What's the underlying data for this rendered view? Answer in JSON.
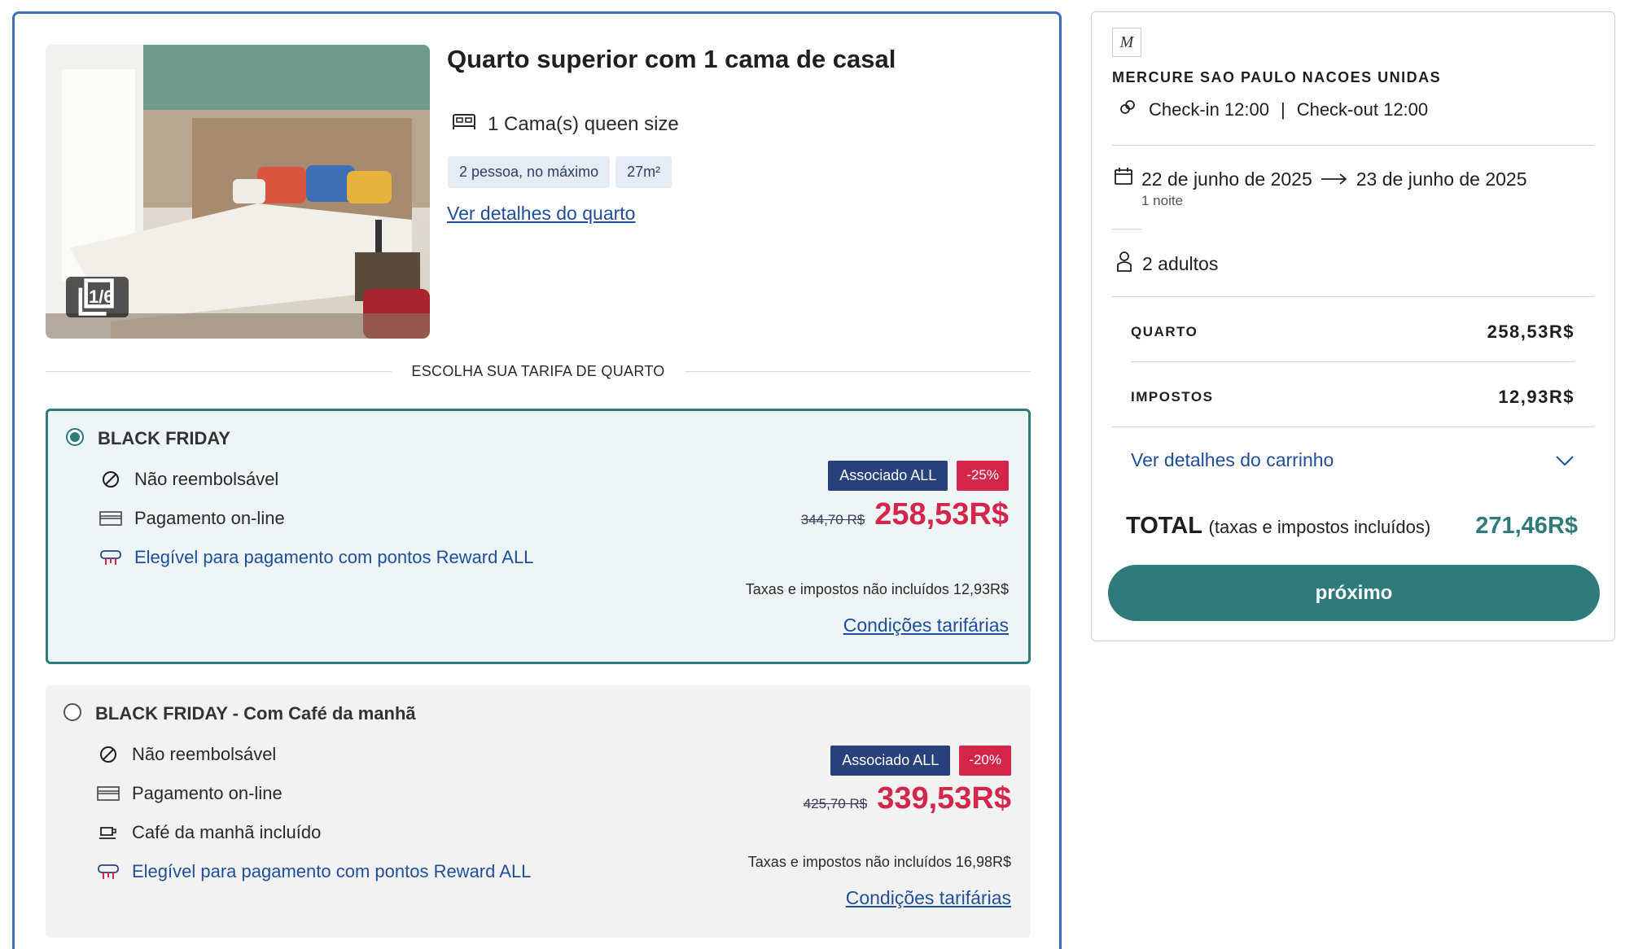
{
  "room": {
    "title": "Quarto superior com 1 cama de casal",
    "photo_counter": "1/6",
    "bed": "1 Cama(s) queen size",
    "chips": [
      "2 pessoa, no máximo",
      "27m²"
    ],
    "details_link": "Ver detalhes do quarto"
  },
  "rate_section_label": "ESCOLHA SUA TARIFA DE QUARTO",
  "rates": [
    {
      "name": "BLACK FRIDAY",
      "selected": true,
      "features": {
        "refund": "Não reembolsável",
        "payment": "Pagamento on-line",
        "reward": "Elegível para pagamento com pontos Reward ALL"
      },
      "badge_member": "Associado ALL",
      "badge_discount": "-25%",
      "old_price": "344,70 R$",
      "new_price": "258,53R$",
      "tax_note": "Taxas e impostos não incluídos 12,93R$",
      "conditions_link": "Condições tarifárias"
    },
    {
      "name": "BLACK FRIDAY - Com Café da manhã",
      "selected": false,
      "features": {
        "refund": "Não reembolsável",
        "payment": "Pagamento on-line",
        "breakfast": "Café da manhã incluído",
        "reward": "Elegível para pagamento com pontos Reward ALL"
      },
      "badge_member": "Associado ALL",
      "badge_discount": "-20%",
      "old_price": "425,70 R$",
      "new_price": "339,53R$",
      "tax_note": "Taxas e impostos não incluídos 16,98R$",
      "conditions_link": "Condições tarifárias"
    }
  ],
  "summary": {
    "logo_mark": "M",
    "hotel_name": "MERCURE SAO PAULO NACOES UNIDAS",
    "checkin": "Check-in 12:00",
    "checkin_sep": "|",
    "checkout": "Check-out 12:00",
    "date_from": "22 de junho de 2025",
    "date_to": "23 de junho de 2025",
    "nights": "1 noite",
    "guests": "2 adultos",
    "room_label": "QUARTO",
    "room_value": "258,53R$",
    "taxes_label": "IMPOSTOS",
    "taxes_value": "12,93R$",
    "cart_link": "Ver detalhes do carrinho",
    "total_label": "TOTAL",
    "total_note": "(taxas e impostos incluídos)",
    "total_value": "271,46R$",
    "next_button": "próximo"
  },
  "colors": {
    "accent_teal": "#2f7a7a",
    "card_border_blue": "#3a6fb8",
    "price_red": "#d3264a",
    "badge_navy": "#27427a",
    "link_blue": "#1f4e9a"
  },
  "icons": [
    "gallery-icon",
    "bed-icon",
    "no-refund-icon",
    "card-icon",
    "reward-icon",
    "coffee-icon",
    "link-icon",
    "calendar-icon",
    "arrow-right-icon",
    "person-icon",
    "chevron-down-icon"
  ]
}
